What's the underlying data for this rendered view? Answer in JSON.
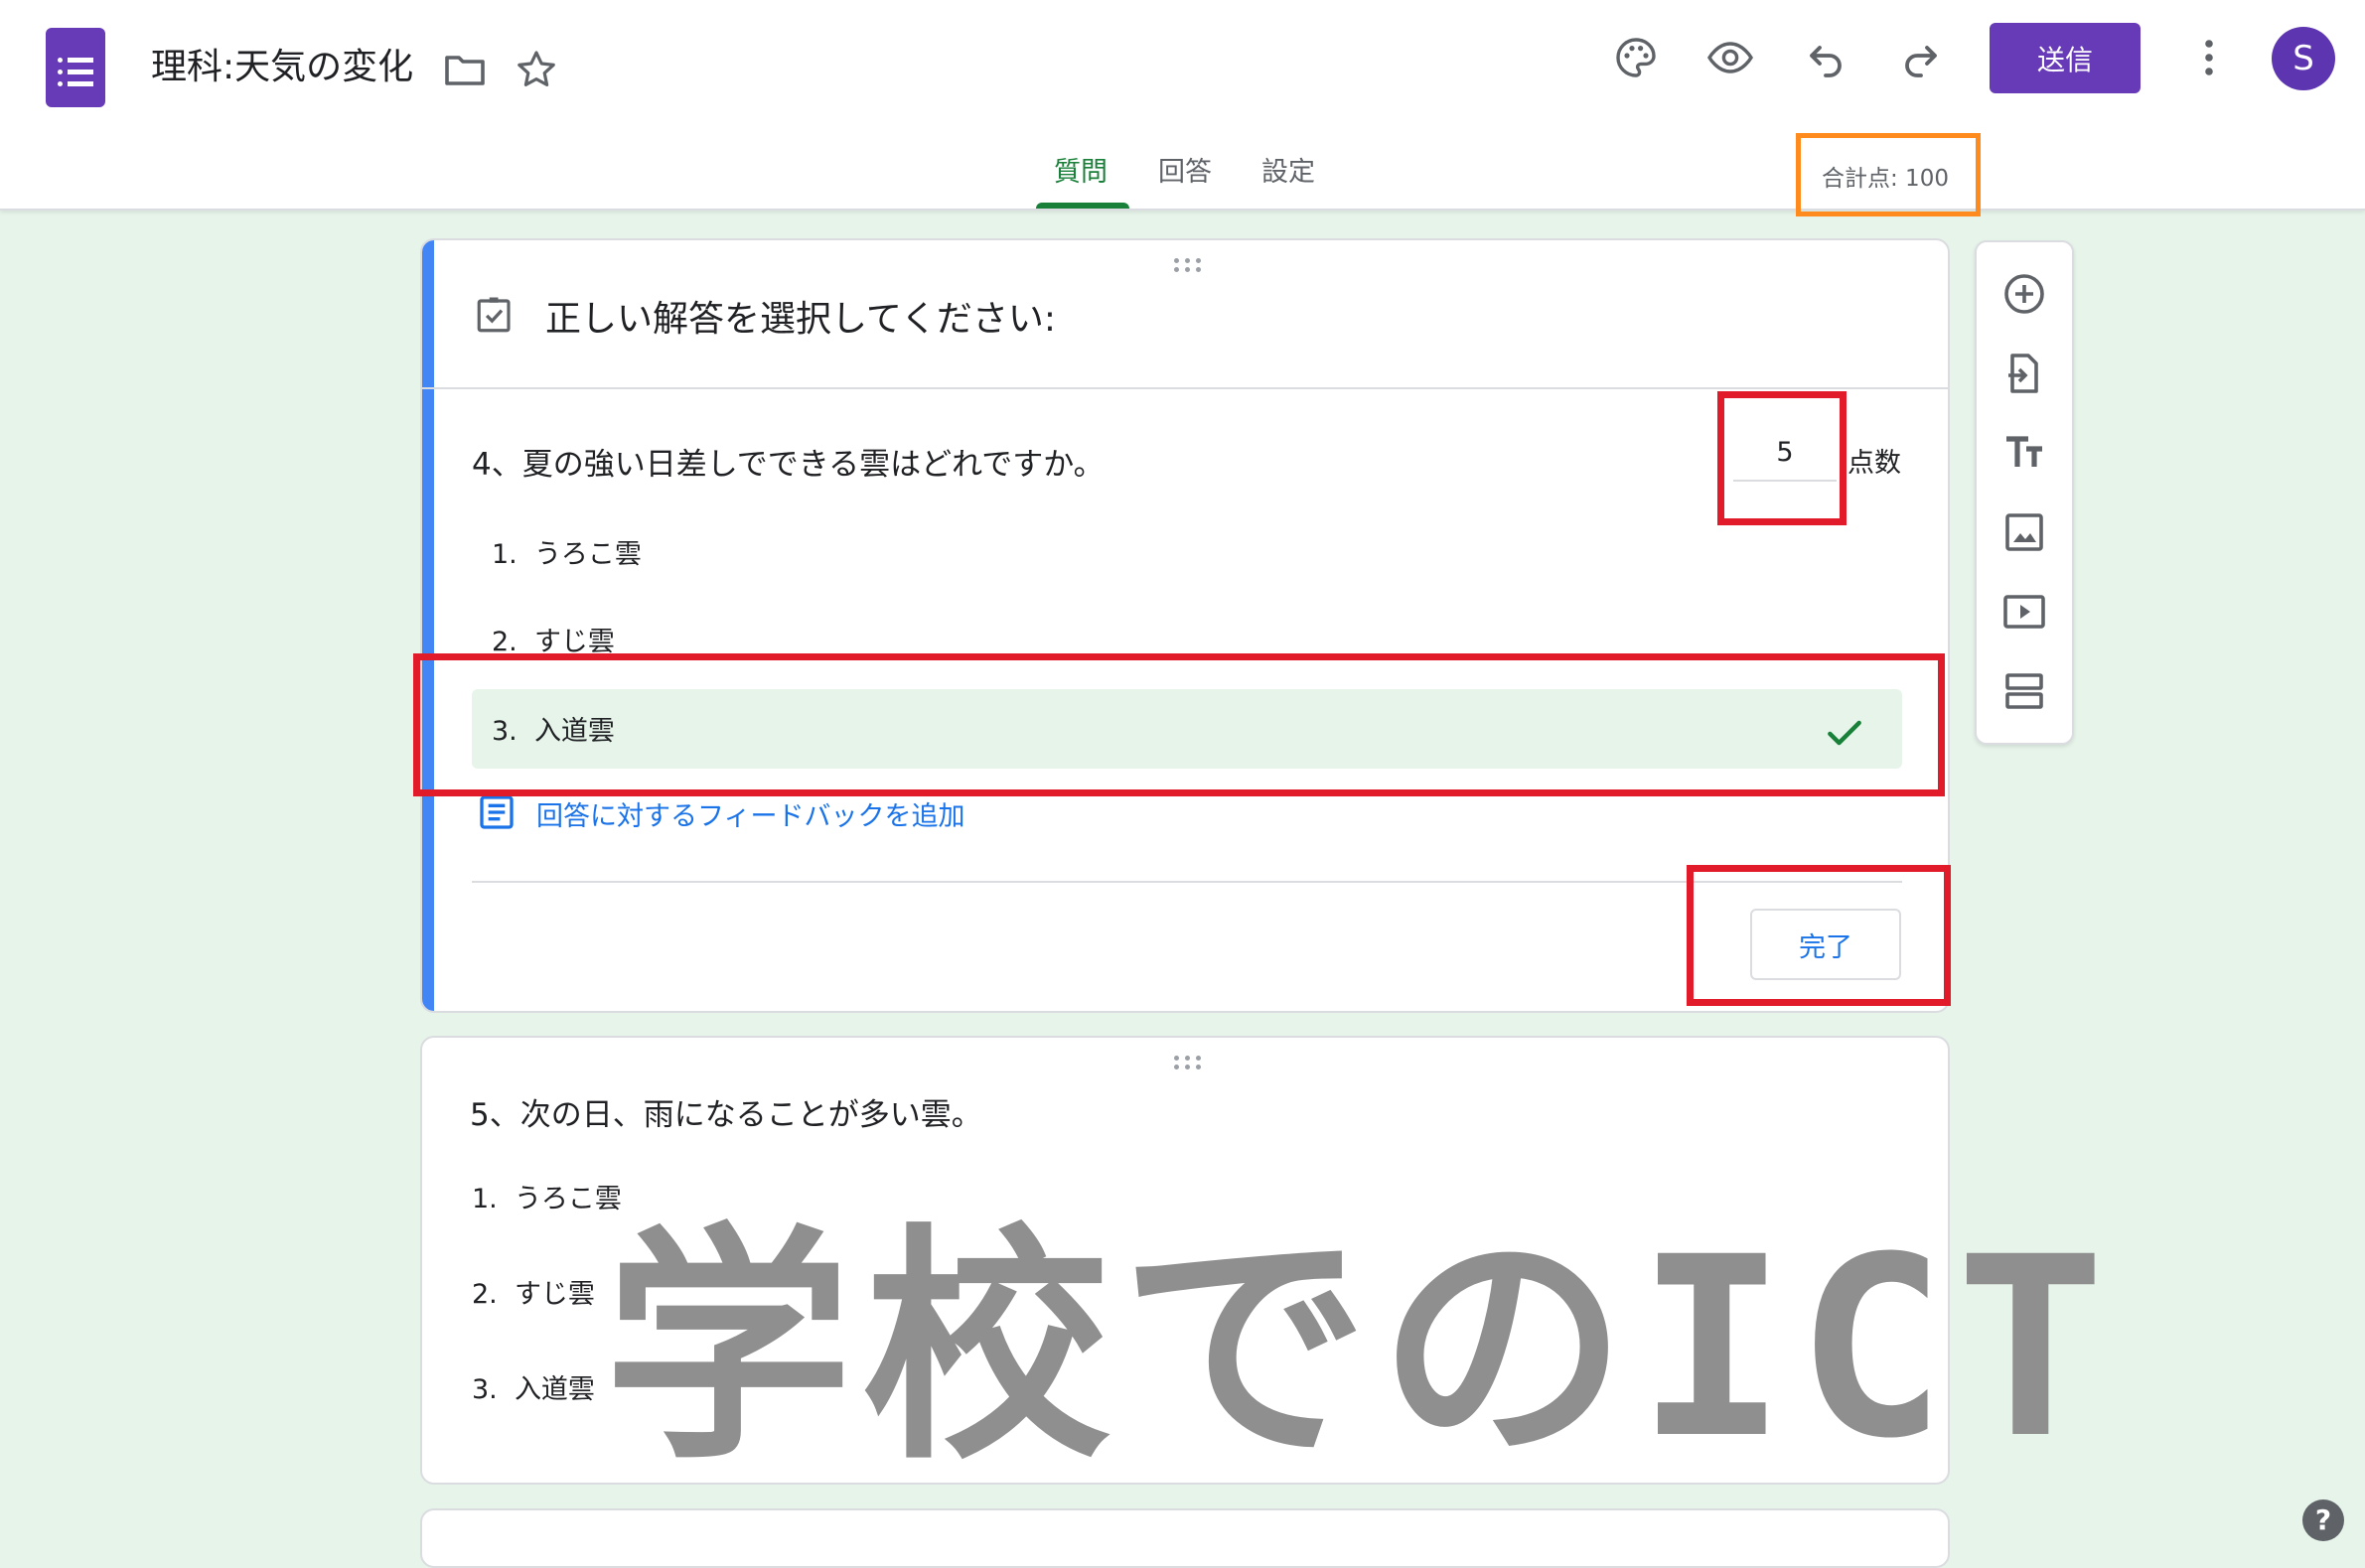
{
  "header": {
    "title": "理科:天気の変化",
    "send_label": "送信",
    "avatar_letter": "S",
    "total_points": "合計点: 100",
    "icons": [
      "folder-icon",
      "star-icon",
      "palette-icon",
      "eye-icon",
      "undo-icon",
      "redo-icon",
      "more-vert-icon"
    ]
  },
  "tabs": [
    {
      "label": "質問",
      "active": true
    },
    {
      "label": "回答",
      "active": false
    },
    {
      "label": "設定",
      "active": false
    }
  ],
  "active_card": {
    "heading": "正しい解答を選択してください:",
    "question": "4、夏の強い日差しでできる雲はどれですか。",
    "points_value": "5",
    "points_label": "点数",
    "options": [
      {
        "number": "1.",
        "label": "うろこ雲",
        "correct": false
      },
      {
        "number": "2.",
        "label": "すじ雲",
        "correct": false
      },
      {
        "number": "3.",
        "label": "入道雲",
        "correct": true
      }
    ],
    "feedback_link": "回答に対するフィードバックを追加",
    "done_label": "完了"
  },
  "next_card": {
    "question": "5、次の日、雨になることが多い雲。",
    "options": [
      {
        "number": "1.",
        "label": "うろこ雲"
      },
      {
        "number": "2.",
        "label": "すじ雲"
      },
      {
        "number": "3.",
        "label": "入道雲"
      }
    ]
  },
  "side_toolbar": [
    "add-question-icon",
    "import-questions-icon",
    "add-title-icon",
    "add-image-icon",
    "add-video-icon",
    "add-section-icon"
  ],
  "watermark": "学校でのICT",
  "colors": {
    "brand": "#673ab7",
    "active_tab": "#188038",
    "accent": "#4285f4",
    "highlight": "#e21b2a",
    "total_box": "#ff8a1e"
  }
}
